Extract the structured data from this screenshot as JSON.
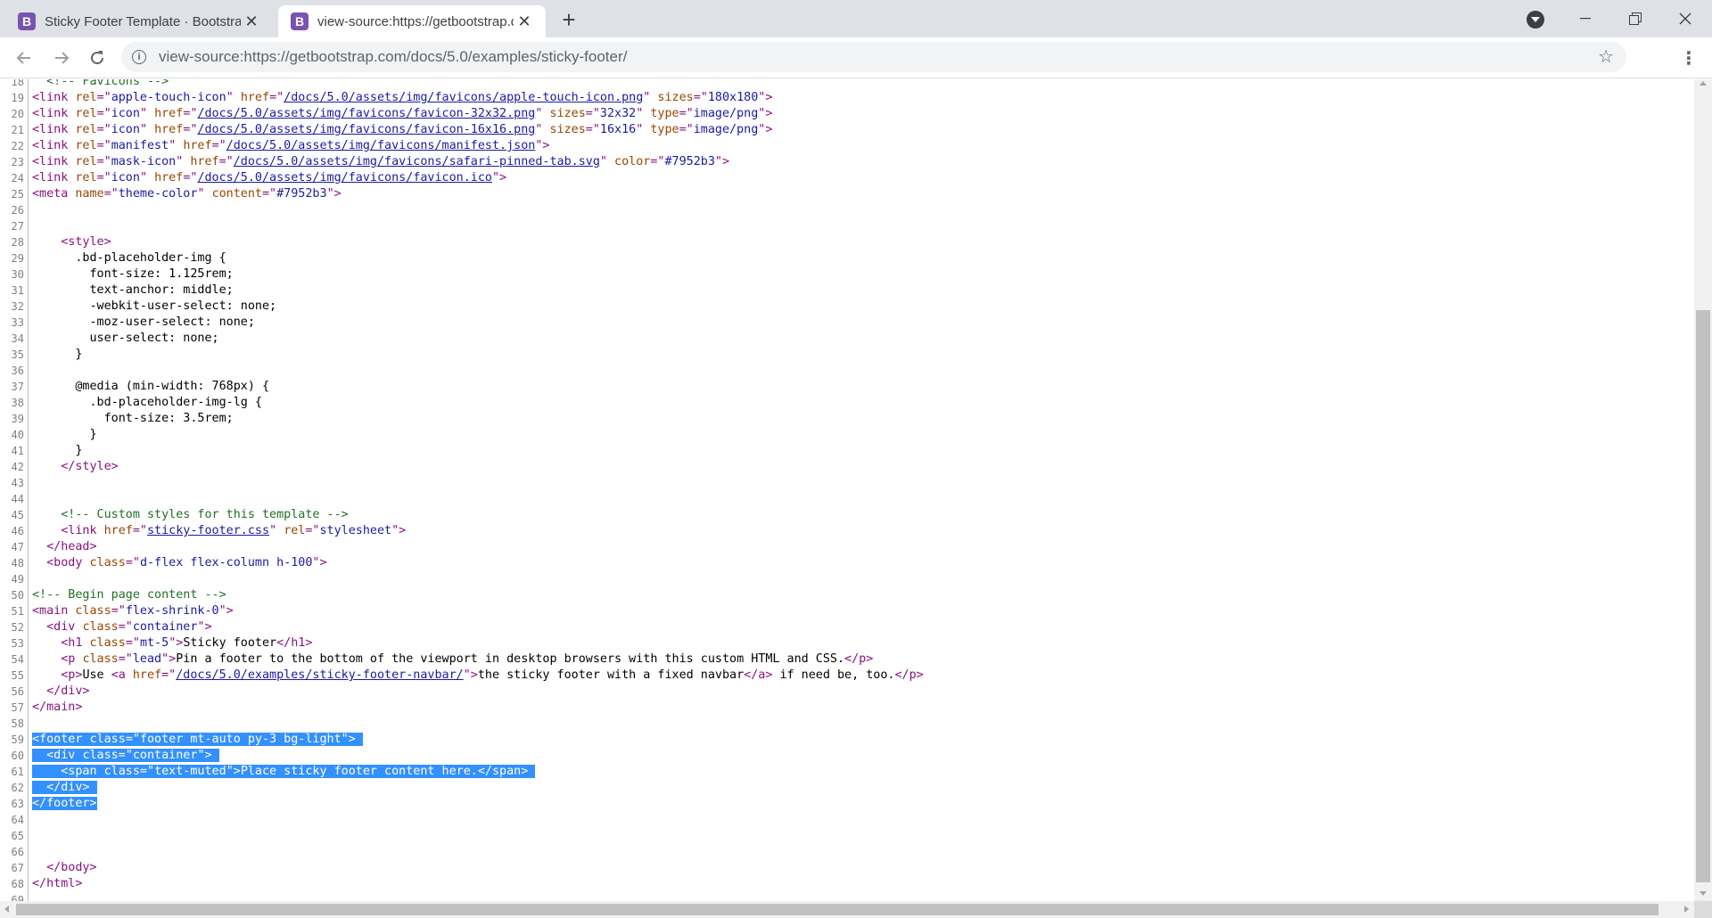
{
  "tabs": [
    {
      "favicon": "B",
      "title": "Sticky Footer Template · Bootstrap"
    },
    {
      "favicon": "B",
      "title": "view-source:https://getbootstrap.com"
    }
  ],
  "toolbar": {
    "url": "view-source:https://getbootstrap.com/docs/5.0/examples/sticky-footer/"
  },
  "icons": {
    "favicon": "bootstrap-logo-icon",
    "tab_close": "close-icon",
    "new_tab": "plus-icon",
    "back": "arrow-left-icon",
    "forward": "arrow-right-icon",
    "reload": "reload-icon",
    "site_info": "info-icon",
    "bookmark": "star-icon",
    "menu": "kebab-menu-icon",
    "profile": "profile-dropdown-icon"
  },
  "colors": {
    "tag": "#881280",
    "attr_name": "#994500",
    "attr_value": "#1a1aa6",
    "comment": "#236e25",
    "selection": "#3390ff"
  },
  "source_lines": [
    {
      "n": "18",
      "html": "  <span class=\"c\">&lt;!-- Favicons --&gt;</span>"
    },
    {
      "n": "19",
      "html": "<span class=\"t\">&lt;link</span> <span class=\"a\">rel</span><span class=\"t\">=\"</span><span class=\"v\">apple-touch-icon</span><span class=\"t\">\"</span> <span class=\"a\">href</span><span class=\"t\">=\"</span><span class=\"u\">/docs/5.0/assets/img/favicons/apple-touch-icon.png</span><span class=\"t\">\"</span> <span class=\"a\">sizes</span><span class=\"t\">=\"</span><span class=\"v\">180x180</span><span class=\"t\">\"&gt;</span>"
    },
    {
      "n": "20",
      "html": "<span class=\"t\">&lt;link</span> <span class=\"a\">rel</span><span class=\"t\">=\"</span><span class=\"v\">icon</span><span class=\"t\">\"</span> <span class=\"a\">href</span><span class=\"t\">=\"</span><span class=\"u\">/docs/5.0/assets/img/favicons/favicon-32x32.png</span><span class=\"t\">\"</span> <span class=\"a\">sizes</span><span class=\"t\">=\"</span><span class=\"v\">32x32</span><span class=\"t\">\"</span> <span class=\"a\">type</span><span class=\"t\">=\"</span><span class=\"v\">image/png</span><span class=\"t\">\"&gt;</span>"
    },
    {
      "n": "21",
      "html": "<span class=\"t\">&lt;link</span> <span class=\"a\">rel</span><span class=\"t\">=\"</span><span class=\"v\">icon</span><span class=\"t\">\"</span> <span class=\"a\">href</span><span class=\"t\">=\"</span><span class=\"u\">/docs/5.0/assets/img/favicons/favicon-16x16.png</span><span class=\"t\">\"</span> <span class=\"a\">sizes</span><span class=\"t\">=\"</span><span class=\"v\">16x16</span><span class=\"t\">\"</span> <span class=\"a\">type</span><span class=\"t\">=\"</span><span class=\"v\">image/png</span><span class=\"t\">\"&gt;</span>"
    },
    {
      "n": "22",
      "html": "<span class=\"t\">&lt;link</span> <span class=\"a\">rel</span><span class=\"t\">=\"</span><span class=\"v\">manifest</span><span class=\"t\">\"</span> <span class=\"a\">href</span><span class=\"t\">=\"</span><span class=\"u\">/docs/5.0/assets/img/favicons/manifest.json</span><span class=\"t\">\"&gt;</span>"
    },
    {
      "n": "23",
      "html": "<span class=\"t\">&lt;link</span> <span class=\"a\">rel</span><span class=\"t\">=\"</span><span class=\"v\">mask-icon</span><span class=\"t\">\"</span> <span class=\"a\">href</span><span class=\"t\">=\"</span><span class=\"u\">/docs/5.0/assets/img/favicons/safari-pinned-tab.svg</span><span class=\"t\">\"</span> <span class=\"a\">color</span><span class=\"t\">=\"</span><span class=\"v\">#7952b3</span><span class=\"t\">\"&gt;</span>"
    },
    {
      "n": "24",
      "html": "<span class=\"t\">&lt;link</span> <span class=\"a\">rel</span><span class=\"t\">=\"</span><span class=\"v\">icon</span><span class=\"t\">\"</span> <span class=\"a\">href</span><span class=\"t\">=\"</span><span class=\"u\">/docs/5.0/assets/img/favicons/favicon.ico</span><span class=\"t\">\"&gt;</span>"
    },
    {
      "n": "25",
      "html": "<span class=\"t\">&lt;meta</span> <span class=\"a\">name</span><span class=\"t\">=\"</span><span class=\"v\">theme-color</span><span class=\"t\">\"</span> <span class=\"a\">content</span><span class=\"t\">=\"</span><span class=\"v\">#7952b3</span><span class=\"t\">\"&gt;</span>"
    },
    {
      "n": "26",
      "html": ""
    },
    {
      "n": "27",
      "html": ""
    },
    {
      "n": "28",
      "html": "    <span class=\"t\">&lt;style&gt;</span>"
    },
    {
      "n": "29",
      "html": "      .bd-placeholder-img {"
    },
    {
      "n": "30",
      "html": "        font-size: 1.125rem;"
    },
    {
      "n": "31",
      "html": "        text-anchor: middle;"
    },
    {
      "n": "32",
      "html": "        -webkit-user-select: none;"
    },
    {
      "n": "33",
      "html": "        -moz-user-select: none;"
    },
    {
      "n": "34",
      "html": "        user-select: none;"
    },
    {
      "n": "35",
      "html": "      }"
    },
    {
      "n": "36",
      "html": ""
    },
    {
      "n": "37",
      "html": "      @media (min-width: 768px) {"
    },
    {
      "n": "38",
      "html": "        .bd-placeholder-img-lg {"
    },
    {
      "n": "39",
      "html": "          font-size: 3.5rem;"
    },
    {
      "n": "40",
      "html": "        }"
    },
    {
      "n": "41",
      "html": "      }"
    },
    {
      "n": "42",
      "html": "    <span class=\"t\">&lt;/style&gt;</span>"
    },
    {
      "n": "43",
      "html": ""
    },
    {
      "n": "44",
      "html": ""
    },
    {
      "n": "45",
      "html": "    <span class=\"c\">&lt;!-- Custom styles for this template --&gt;</span>"
    },
    {
      "n": "46",
      "html": "    <span class=\"t\">&lt;link</span> <span class=\"a\">href</span><span class=\"t\">=\"</span><span class=\"u\">sticky-footer.css</span><span class=\"t\">\"</span> <span class=\"a\">rel</span><span class=\"t\">=\"</span><span class=\"v\">stylesheet</span><span class=\"t\">\"&gt;</span>"
    },
    {
      "n": "47",
      "html": "  <span class=\"t\">&lt;/head&gt;</span>"
    },
    {
      "n": "48",
      "html": "  <span class=\"t\">&lt;body</span> <span class=\"a\">class</span><span class=\"t\">=\"</span><span class=\"v\">d-flex flex-column h-100</span><span class=\"t\">\"&gt;</span>"
    },
    {
      "n": "49",
      "html": ""
    },
    {
      "n": "50",
      "html": "<span class=\"c\">&lt;!-- Begin page content --&gt;</span>"
    },
    {
      "n": "51",
      "html": "<span class=\"t\">&lt;main</span> <span class=\"a\">class</span><span class=\"t\">=\"</span><span class=\"v\">flex-shrink-0</span><span class=\"t\">\"&gt;</span>"
    },
    {
      "n": "52",
      "html": "  <span class=\"t\">&lt;div</span> <span class=\"a\">class</span><span class=\"t\">=\"</span><span class=\"v\">container</span><span class=\"t\">\"&gt;</span>"
    },
    {
      "n": "53",
      "html": "    <span class=\"t\">&lt;h1</span> <span class=\"a\">class</span><span class=\"t\">=\"</span><span class=\"v\">mt-5</span><span class=\"t\">\"&gt;</span>Sticky footer<span class=\"t\">&lt;/h1&gt;</span>"
    },
    {
      "n": "54",
      "html": "    <span class=\"t\">&lt;p</span> <span class=\"a\">class</span><span class=\"t\">=\"</span><span class=\"v\">lead</span><span class=\"t\">\"&gt;</span>Pin a footer to the bottom of the viewport in desktop browsers with this custom HTML and CSS.<span class=\"t\">&lt;/p&gt;</span>"
    },
    {
      "n": "55",
      "html": "    <span class=\"t\">&lt;p&gt;</span>Use <span class=\"t\">&lt;a</span> <span class=\"a\">href</span><span class=\"t\">=\"</span><span class=\"u\">/docs/5.0/examples/sticky-footer-navbar/</span><span class=\"t\">\"&gt;</span>the sticky footer with a fixed navbar<span class=\"t\">&lt;/a&gt;</span> if need be, too.<span class=\"t\">&lt;/p&gt;</span>"
    },
    {
      "n": "56",
      "html": "  <span class=\"t\">&lt;/div&gt;</span>"
    },
    {
      "n": "57",
      "html": "<span class=\"t\">&lt;/main&gt;</span>"
    },
    {
      "n": "58",
      "html": ""
    },
    {
      "n": "59",
      "html": "<span class=\"sel\"><span class=\"t\">&lt;footer</span> <span class=\"a\">class</span><span class=\"t\">=\"</span><span class=\"v\">footer mt-auto py-3 bg-light</span><span class=\"t\">\"&gt;</span> </span>"
    },
    {
      "n": "60",
      "html": "<span class=\"sel\">  <span class=\"t\">&lt;div</span> <span class=\"a\">class</span><span class=\"t\">=\"</span><span class=\"v\">container</span><span class=\"t\">\"&gt;</span> </span>"
    },
    {
      "n": "61",
      "html": "<span class=\"sel\">    <span class=\"t\">&lt;span</span> <span class=\"a\">class</span><span class=\"t\">=\"</span><span class=\"v\">text-muted</span><span class=\"t\">\"&gt;</span>Place sticky footer content here.<span class=\"t\">&lt;/span&gt;</span> </span>"
    },
    {
      "n": "62",
      "html": "<span class=\"sel\">  <span class=\"t\">&lt;/div&gt;</span> </span>"
    },
    {
      "n": "63",
      "html": "<span class=\"sel\"><span class=\"t\">&lt;/footer&gt;</span></span>"
    },
    {
      "n": "64",
      "html": ""
    },
    {
      "n": "65",
      "html": ""
    },
    {
      "n": "66",
      "html": ""
    },
    {
      "n": "67",
      "html": "  <span class=\"t\">&lt;/body&gt;</span>"
    },
    {
      "n": "68",
      "html": "<span class=\"t\">&lt;/html&gt;</span>"
    },
    {
      "n": "69",
      "html": ""
    }
  ]
}
